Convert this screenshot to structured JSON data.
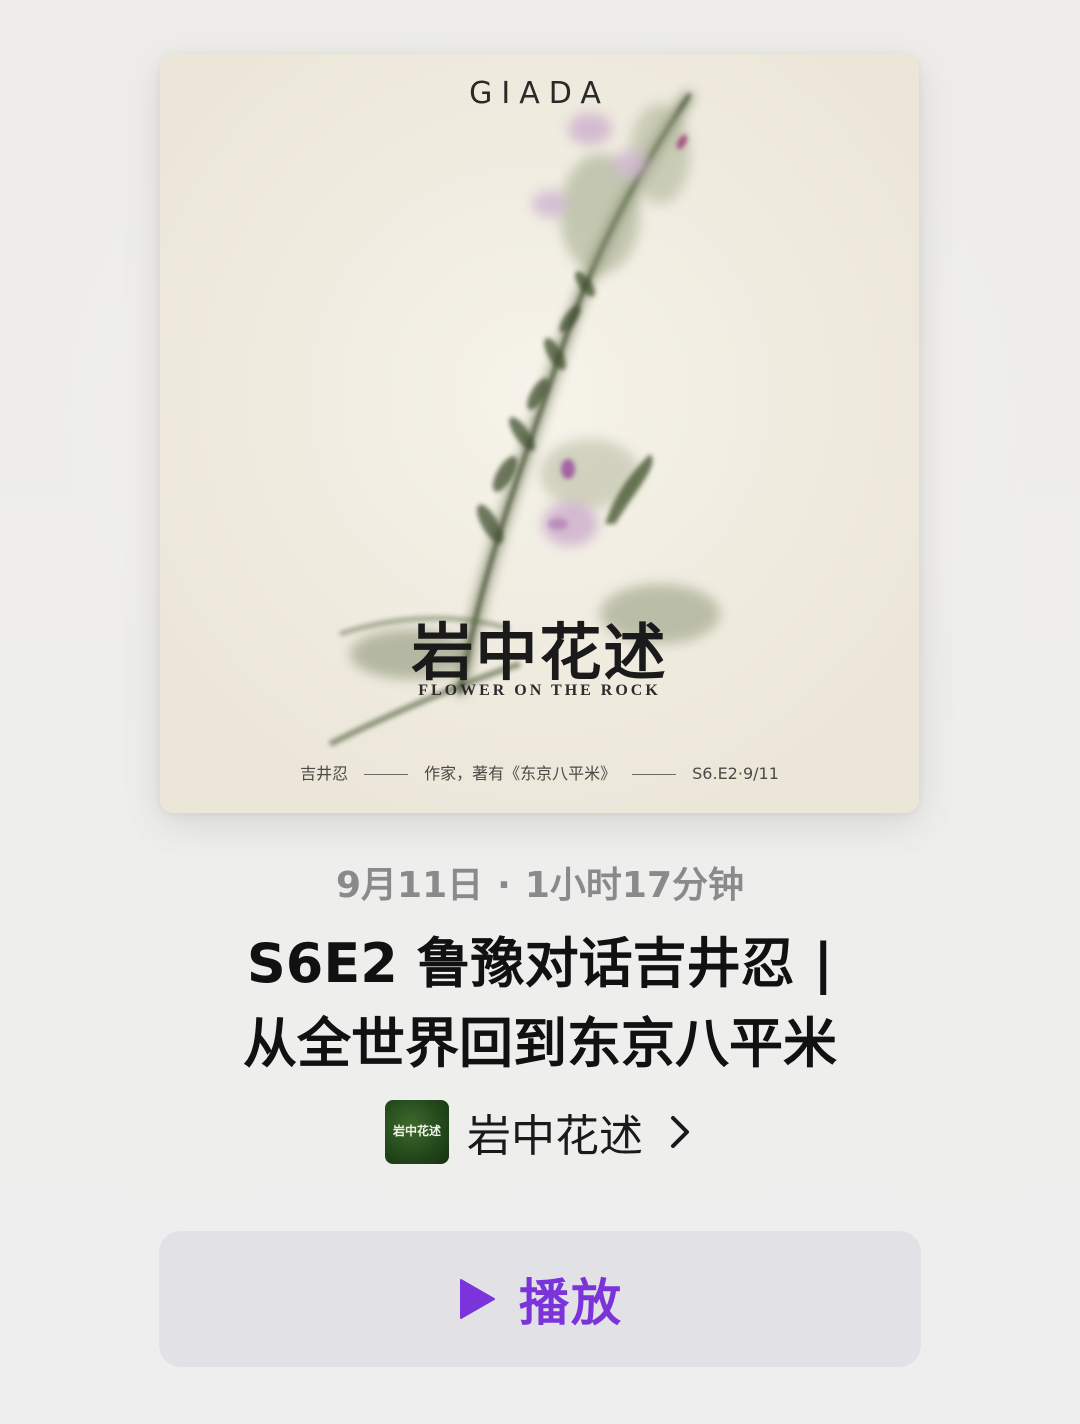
{
  "artwork": {
    "brand": "GIADA",
    "show_title_cn": "岩中花述",
    "show_title_en": "FLOWER ON THE ROCK",
    "credits": {
      "guest": "吉井忍",
      "description": "作家，著有《东京八平米》",
      "episode_code": "S6.E2·9/11"
    }
  },
  "episode": {
    "date": "9月11日",
    "separator": "·",
    "duration": "1小时17分钟",
    "title_line1": "S6E2 鲁豫对话吉井忍 |",
    "title_line2": "从全世界回到东京八平米"
  },
  "show": {
    "thumb_text": "岩中花述",
    "name": "岩中花述",
    "chevron_icon": "chevron-right-icon"
  },
  "actions": {
    "play_label": "播放",
    "play_icon": "play-icon",
    "accent_color": "#7b34d9"
  }
}
